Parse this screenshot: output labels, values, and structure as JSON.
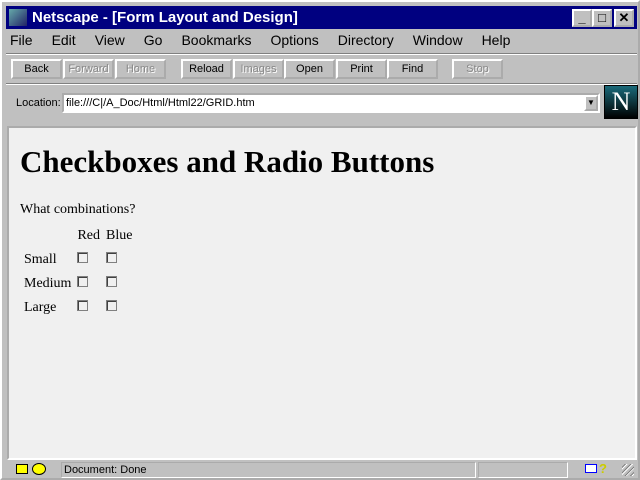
{
  "window": {
    "title": "Netscape - [Form Layout and Design]",
    "minimize": "_",
    "maximize": "□",
    "close": "✕"
  },
  "menu": [
    "File",
    "Edit",
    "View",
    "Go",
    "Bookmarks",
    "Options",
    "Directory",
    "Window",
    "Help"
  ],
  "toolbar": [
    {
      "label": "Back",
      "enabled": true
    },
    {
      "label": "Forward",
      "enabled": false
    },
    {
      "label": "Home",
      "enabled": false
    },
    {
      "label": "Reload",
      "enabled": true
    },
    {
      "label": "Images",
      "enabled": false
    },
    {
      "label": "Open",
      "enabled": true
    },
    {
      "label": "Print",
      "enabled": true
    },
    {
      "label": "Find",
      "enabled": true
    },
    {
      "label": "Stop",
      "enabled": false
    }
  ],
  "location": {
    "label": "Location:",
    "value": "file:///C|/A_Doc/Html/Html22/GRID.htm",
    "dropdown": "▼"
  },
  "logo": "N",
  "page": {
    "heading": "Checkboxes and Radio Buttons",
    "question": "What combinations?",
    "columns": [
      "Red",
      "Blue"
    ],
    "rows": [
      {
        "label": "Small",
        "checked": [
          false,
          false
        ]
      },
      {
        "label": "Medium",
        "checked": [
          false,
          false
        ]
      },
      {
        "label": "Large",
        "checked": [
          false,
          false
        ]
      }
    ]
  },
  "status": {
    "text": "Document: Done",
    "help": "?"
  }
}
